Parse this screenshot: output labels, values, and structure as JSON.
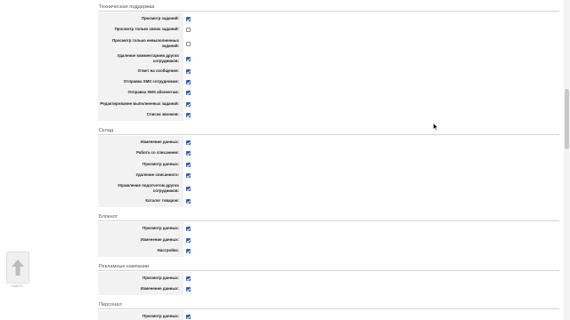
{
  "sections": [
    {
      "title": "Техническая поддержка",
      "rows": [
        {
          "label": "Просмотр заданий:",
          "checked": true
        },
        {
          "label": "Просмотр только своих заданий:",
          "checked": false
        },
        {
          "label": "Просмотр только невыполненных заданий:",
          "checked": false
        },
        {
          "label": "Удаление комментариев других сотрудников:",
          "checked": true
        },
        {
          "label": "Ответ на сообщения:",
          "checked": true
        },
        {
          "label": "Отправка SMS сотрудникам:",
          "checked": true
        },
        {
          "label": "Отправка SMS абонентам:",
          "checked": true
        },
        {
          "label": "Редактирование выполненных заданий:",
          "checked": true
        },
        {
          "label": "Список звонков:",
          "checked": true
        }
      ]
    },
    {
      "title": "Склад",
      "rows": [
        {
          "label": "Изменение данных:",
          "checked": true
        },
        {
          "label": "Работа со списанием:",
          "checked": true
        },
        {
          "label": "Просмотр данных:",
          "checked": true
        },
        {
          "label": "Удаление списанного:",
          "checked": true
        },
        {
          "label": "Управление подотчетом других сотрудников:",
          "checked": true
        },
        {
          "label": "Каталог товаров:",
          "checked": true
        }
      ]
    },
    {
      "title": "Блокнот",
      "rows": [
        {
          "label": "Просмотр данных:",
          "checked": true
        },
        {
          "label": "Изменение данных:",
          "checked": true
        },
        {
          "label": "Настройка:",
          "checked": true
        }
      ]
    },
    {
      "title": "Рекламные кампании",
      "rows": [
        {
          "label": "Просмотр данных:",
          "checked": true
        },
        {
          "label": "Изменение данных:",
          "checked": true
        }
      ]
    },
    {
      "title": "Персонал",
      "rows": [
        {
          "label": "Просмотр данных:",
          "checked": true
        }
      ]
    }
  ],
  "scroll_top_button": {
    "label": "НАВЕРХ",
    "icon": "arrow-up-icon"
  },
  "colors": {
    "checkbox_checked": "#2a5fb4",
    "label_background": "#f2f2f2",
    "divider": "#d4d4d4"
  }
}
